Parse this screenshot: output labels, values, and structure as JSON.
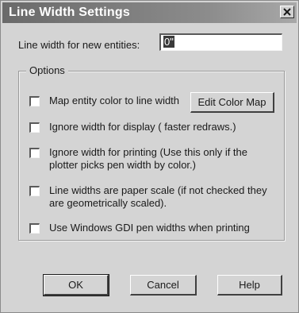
{
  "window": {
    "title": "Line Width Settings"
  },
  "line_width": {
    "label": "Line width for new entities:",
    "value": "0\""
  },
  "options": {
    "group_label": "Options",
    "items": [
      {
        "label": "Map entity color to line width",
        "checked": false
      },
      {
        "label": "Ignore width for display ( faster redraws.)",
        "checked": false
      },
      {
        "label": "Ignore width for printing (Use this only if the plotter picks pen width by color.)",
        "checked": false
      },
      {
        "label": "Line widths are paper scale (if not checked they are geometrically scaled).",
        "checked": false
      },
      {
        "label": "Use Windows GDI pen widths when printing",
        "checked": false
      }
    ],
    "edit_color_map_label": "Edit Color Map"
  },
  "buttons": {
    "ok": "OK",
    "cancel": "Cancel",
    "help": "Help"
  },
  "icons": {
    "close": "close-icon"
  }
}
